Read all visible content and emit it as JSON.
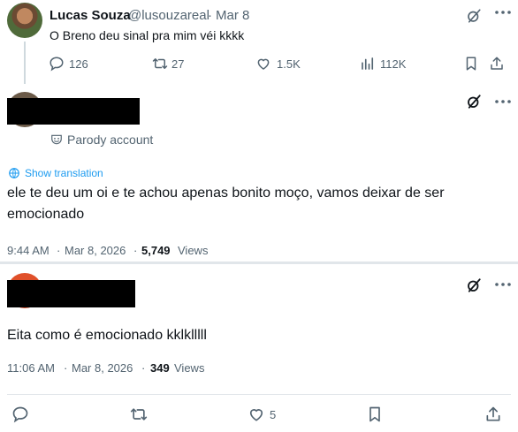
{
  "post1": {
    "display_name": "Lucas Souza",
    "handle": "@lusouzareal",
    "separator": "·",
    "date": "Mar 8",
    "text": "O Breno deu sinal pra mim véi kkkk",
    "replies": "126",
    "reposts": "27",
    "likes": "1.5K",
    "views": "112K"
  },
  "post2": {
    "parody_label": "Parody account",
    "show_translation": "Show translation",
    "text_line1": "ele te deu um oi e te achou apenas bonito moço, vamos deixar de ser",
    "text_line2": "emocionado",
    "time": "9:44 AM",
    "dot": "·",
    "date": "Mar 8, 2026",
    "dot2": "·",
    "views_count": "5,749",
    "views_label": "Views"
  },
  "post3": {
    "text": "Eita como é emocionado kklklllll",
    "time": "11:06 AM",
    "dot": "·",
    "date": "Mar 8, 2026",
    "dot2": "·",
    "views_count": "349",
    "views_label": "Views",
    "likes": "5"
  },
  "colors": {
    "text": "#0f1419",
    "muted": "#536471",
    "link": "#1d9bf0",
    "divider": "#e1e6ea"
  }
}
